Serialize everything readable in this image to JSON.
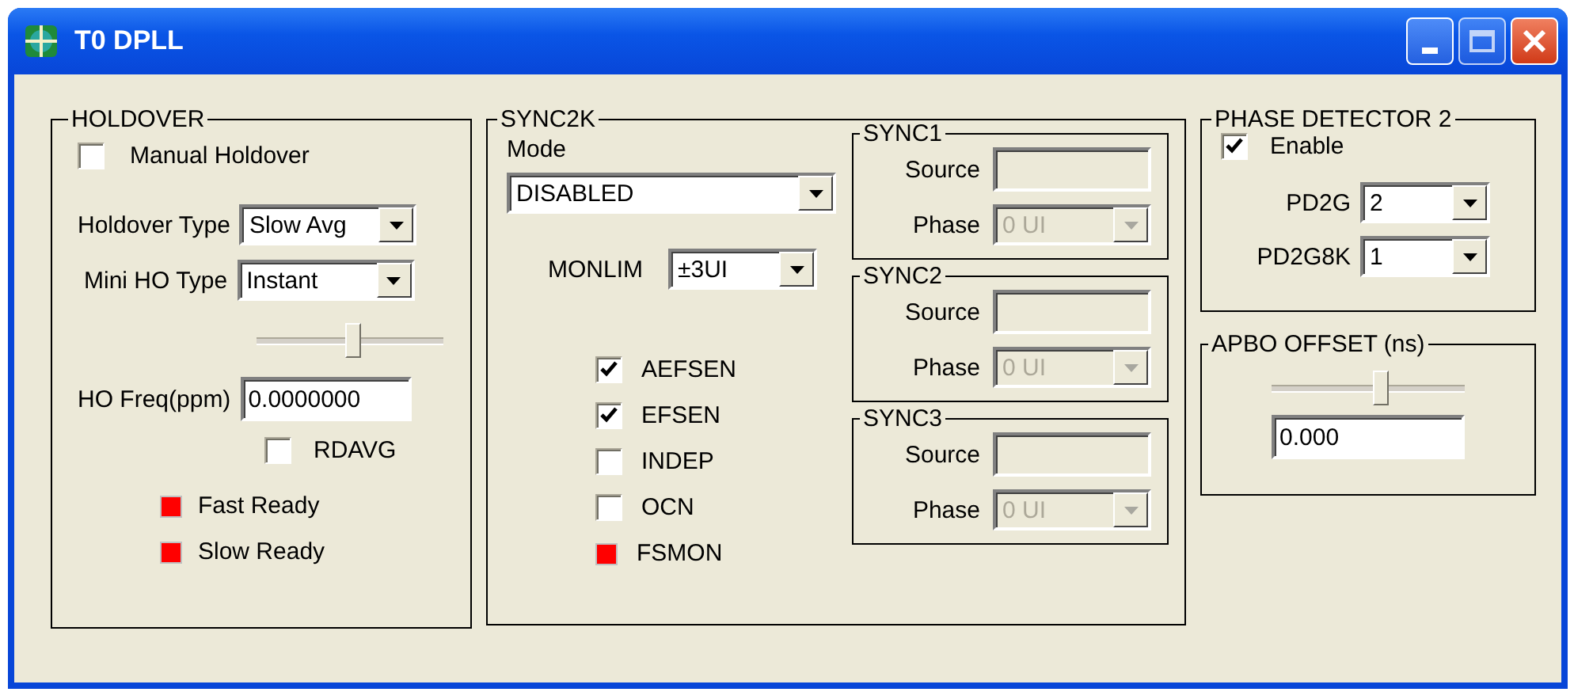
{
  "window": {
    "title": "T0 DPLL"
  },
  "holdover": {
    "title": "HOLDOVER",
    "manual_holdover": {
      "label": "Manual Holdover",
      "checked": false
    },
    "holdover_type": {
      "label": "Holdover Type",
      "value": "Slow Avg"
    },
    "mini_ho_type": {
      "label": "Mini HO Type",
      "value": "Instant"
    },
    "slider": {
      "level": 0.52
    },
    "ho_freq": {
      "label": "HO Freq(ppm)",
      "value": "0.0000000"
    },
    "rdavg": {
      "label": "RDAVG",
      "checked": false
    },
    "indicators": [
      {
        "label": "Fast Ready",
        "color": "#ff0000"
      },
      {
        "label": "Slow Ready",
        "color": "#ff0000"
      }
    ]
  },
  "sync2k": {
    "title": "SYNC2K",
    "mode": {
      "label": "Mode",
      "value": "DISABLED"
    },
    "monlim": {
      "label": "MONLIM",
      "value": "±3UI"
    },
    "flags": [
      {
        "label": "AEFSEN",
        "checked": true
      },
      {
        "label": "EFSEN",
        "checked": true
      },
      {
        "label": "INDEP",
        "checked": false
      },
      {
        "label": "OCN",
        "checked": false
      }
    ],
    "indicator": {
      "label": "FSMON",
      "color": "#ff0000"
    },
    "syncs": [
      {
        "title": "SYNC1",
        "source_label": "Source",
        "phase_label": "Phase",
        "phase_value": "0 UI",
        "disabled": true
      },
      {
        "title": "SYNC2",
        "source_label": "Source",
        "phase_label": "Phase",
        "phase_value": "0 UI",
        "disabled": true
      },
      {
        "title": "SYNC3",
        "source_label": "Source",
        "phase_label": "Phase",
        "phase_value": "0 UI",
        "disabled": true
      }
    ]
  },
  "phase_detector": {
    "title": "PHASE DETECTOR 2",
    "enable": {
      "label": "Enable",
      "checked": true
    },
    "pd2g": {
      "label": "PD2G",
      "value": "2"
    },
    "pd2g8k": {
      "label": "PD2G8K",
      "value": "1"
    }
  },
  "apbo": {
    "title": "APBO OFFSET (ns)",
    "slider": {
      "level": 0.57
    },
    "value": "0.000"
  }
}
